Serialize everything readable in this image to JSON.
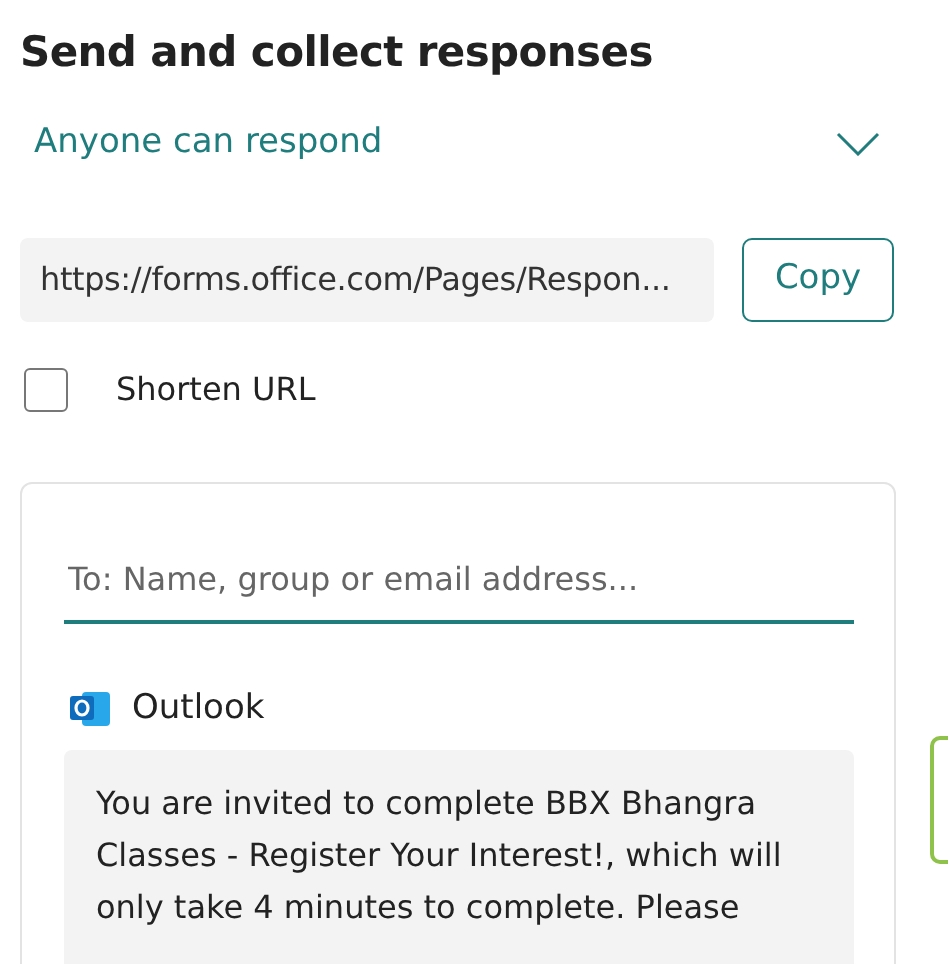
{
  "title": "Send and collect responses",
  "audience": {
    "label": "Anyone can respond"
  },
  "link": {
    "url": "https://forms.office.com/Pages/Respon...",
    "copy_label": "Copy"
  },
  "shorten_url": {
    "label": "Shorten URL",
    "checked": false
  },
  "email": {
    "placeholder": "To: Name, group or email address...",
    "app": "Outlook",
    "message": "You are invited to complete BBX Bhangra Classes - Register Your Interest!, which will only take 4 minutes to complete. Please"
  }
}
